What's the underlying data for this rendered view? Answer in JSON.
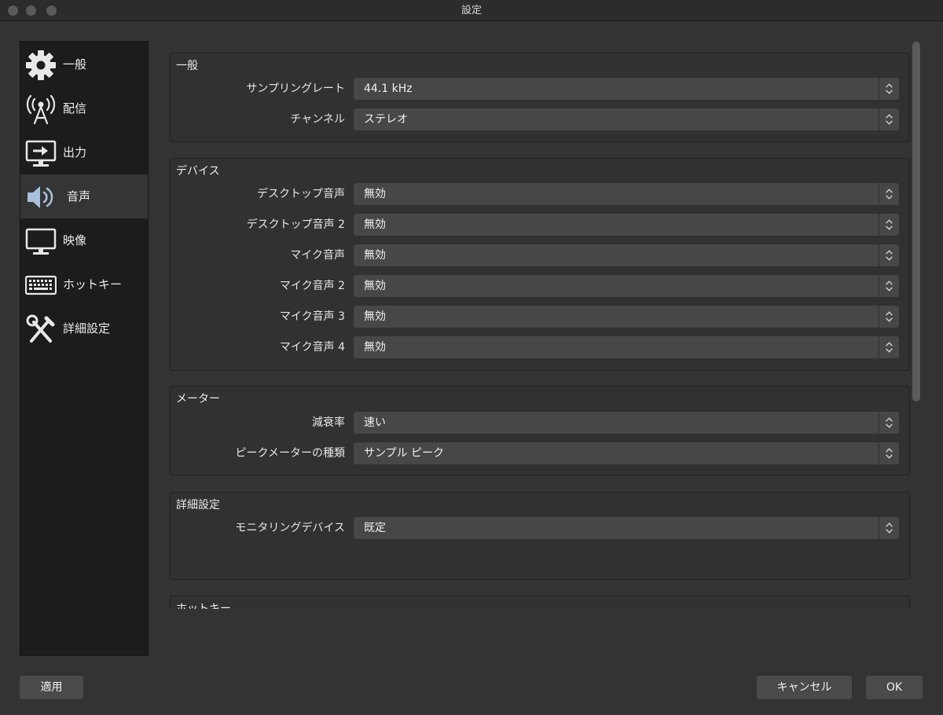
{
  "window": {
    "title": "設定"
  },
  "sidebar": {
    "items": [
      {
        "label": "一般",
        "icon": "gear-icon"
      },
      {
        "label": "配信",
        "icon": "broadcast-antenna-icon"
      },
      {
        "label": "出力",
        "icon": "output-monitor-icon"
      },
      {
        "label": "音声",
        "icon": "speaker-icon",
        "active": true
      },
      {
        "label": "映像",
        "icon": "monitor-icon"
      },
      {
        "label": "ホットキー",
        "icon": "keyboard-icon"
      },
      {
        "label": "詳細設定",
        "icon": "tools-icon"
      }
    ]
  },
  "general": {
    "title": "一般",
    "sample_rate": {
      "label": "サンプリングレート",
      "value": "44.1 kHz"
    },
    "channels": {
      "label": "チャンネル",
      "value": "ステレオ"
    }
  },
  "devices": {
    "title": "デバイス",
    "rows": [
      {
        "label": "デスクトップ音声",
        "value": "無効"
      },
      {
        "label": "デスクトップ音声 2",
        "value": "無効"
      },
      {
        "label": "マイク音声",
        "value": "無効"
      },
      {
        "label": "マイク音声 2",
        "value": "無効"
      },
      {
        "label": "マイク音声 3",
        "value": "無効"
      },
      {
        "label": "マイク音声 4",
        "value": "無効"
      }
    ]
  },
  "meters": {
    "title": "メーター",
    "decay_rate": {
      "label": "減衰率",
      "value": "速い"
    },
    "peak_meter_type": {
      "label": "ピークメーターの種類",
      "value": "サンプル ピーク"
    }
  },
  "advanced": {
    "title": "詳細設定",
    "monitoring_device": {
      "label": "モニタリングデバイス",
      "value": "既定"
    }
  },
  "hotkeys": {
    "title": "ホットキー"
  },
  "buttons": {
    "apply": "適用",
    "cancel": "キャンセル",
    "ok": "OK"
  },
  "colors": {
    "window_bg": "#333333",
    "sidebar_bg": "#1c1c1c",
    "select_bg": "#474747",
    "button_bg": "#4a4a4a",
    "accent": "#a9c0dc"
  }
}
